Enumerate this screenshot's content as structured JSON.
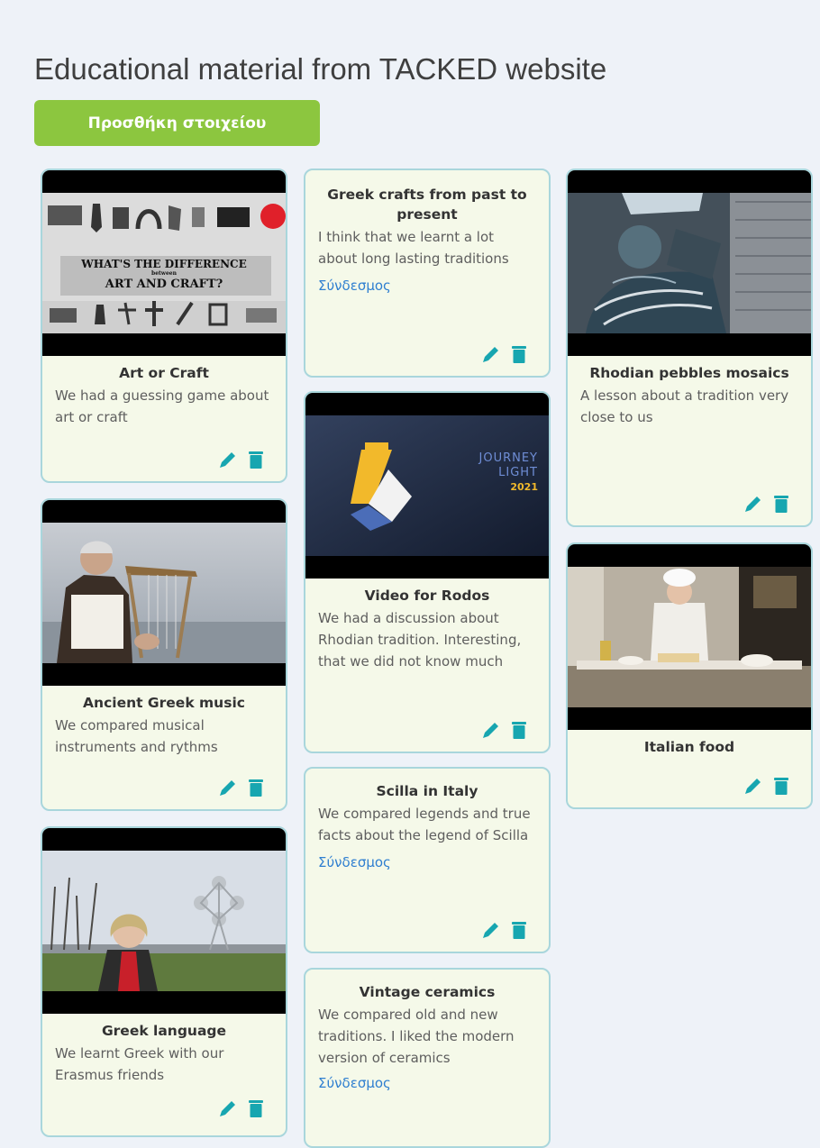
{
  "board": {
    "title": "Educational material from TACKED website",
    "add_button": "Προσθήκη στοιχείου"
  },
  "cards": {
    "art_craft": {
      "title": "Art or Craft",
      "description": "We had a guessing game about art or craft",
      "thumb_heading": "WHAT'S THE DIFFERENCE",
      "thumb_between": "between",
      "thumb_subheading": "ART AND CRAFT?"
    },
    "music": {
      "title": "Ancient Greek music",
      "description": "We compared musical instruments and rythms"
    },
    "language": {
      "title": "Greek language",
      "description": "We learnt Greek with our Erasmus friends"
    },
    "crafts": {
      "title": "Greek crafts from past to present",
      "description": "I think that we learnt a lot about long lasting traditions",
      "link": "Σύνδεσμος"
    },
    "rodos": {
      "title": "Video for Rodos",
      "description": "We had a discussion about Rhodian tradition. Interesting, that we did not know much",
      "thumb_line1": "JOURNEY",
      "thumb_line2": "LIGHT",
      "thumb_year": "2021"
    },
    "scilla": {
      "title": "Scilla in Italy",
      "description": "We compared legends and true facts about the legend of Scilla",
      "link": "Σύνδεσμος"
    },
    "ceramics": {
      "title": "Vintage ceramics",
      "description": "We compared old and new traditions. I liked the modern version of ceramics",
      "link": "Σύνδεσμος"
    },
    "mosaics": {
      "title": "Rhodian pebbles mosaics",
      "description": "A lesson about a tradition very close to us"
    },
    "italian": {
      "title": "Italian food",
      "description": ""
    }
  },
  "icons": {
    "edit": "pencil-icon",
    "delete": "trash-icon"
  },
  "colors": {
    "accent_green": "#8cc63f",
    "card_bg": "#f5f9e9",
    "card_border": "#a9d6dc",
    "link": "#2f7fd0",
    "icon_teal": "#17a6b0"
  }
}
